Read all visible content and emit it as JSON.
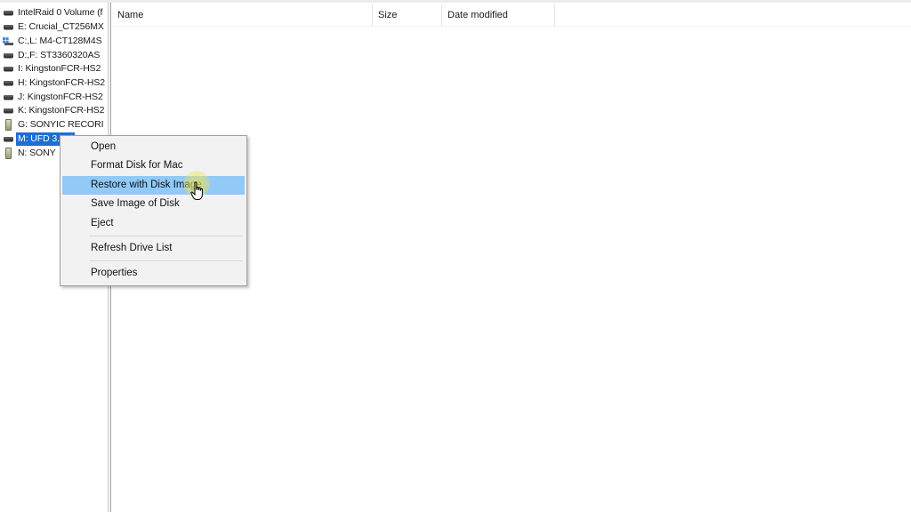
{
  "drives": [
    {
      "label": "IntelRaid 0 Volume (f",
      "icon": "hard-drive-icon"
    },
    {
      "label": "E: Crucial_CT256MX",
      "icon": "hard-drive-icon"
    },
    {
      "label": "C:,L: M4-CT128M4S",
      "icon": "system-drive-icon"
    },
    {
      "label": "D:,F: ST3360320AS",
      "icon": "hard-drive-icon"
    },
    {
      "label": "I: KingstonFCR-HS2",
      "icon": "hard-drive-icon"
    },
    {
      "label": "H: KingstonFCR-HS2",
      "icon": "hard-drive-icon"
    },
    {
      "label": "J: KingstonFCR-HS2",
      "icon": "hard-drive-icon"
    },
    {
      "label": "K: KingstonFCR-HS2",
      "icon": "hard-drive-icon"
    },
    {
      "label": "G: SONYIC RECORI",
      "icon": "memory-card-icon"
    },
    {
      "label": "M: UFD 3.0Si",
      "icon": "hard-drive-icon",
      "selected": true
    },
    {
      "label": "N: SONY",
      "icon": "memory-card-icon"
    }
  ],
  "columns": {
    "name": "Name",
    "size": "Size",
    "date_modified": "Date modified"
  },
  "context_menu": {
    "open": "Open",
    "format": "Format Disk for Mac",
    "restore": "Restore with Disk Image",
    "save_image": "Save Image of Disk",
    "eject": "Eject",
    "refresh": "Refresh Drive List",
    "properties": "Properties",
    "highlighted": "restore"
  },
  "colors": {
    "selection": "#1d6ed6",
    "menu_highlight": "#91c9f7",
    "cursor_halo": "#f0e450"
  }
}
